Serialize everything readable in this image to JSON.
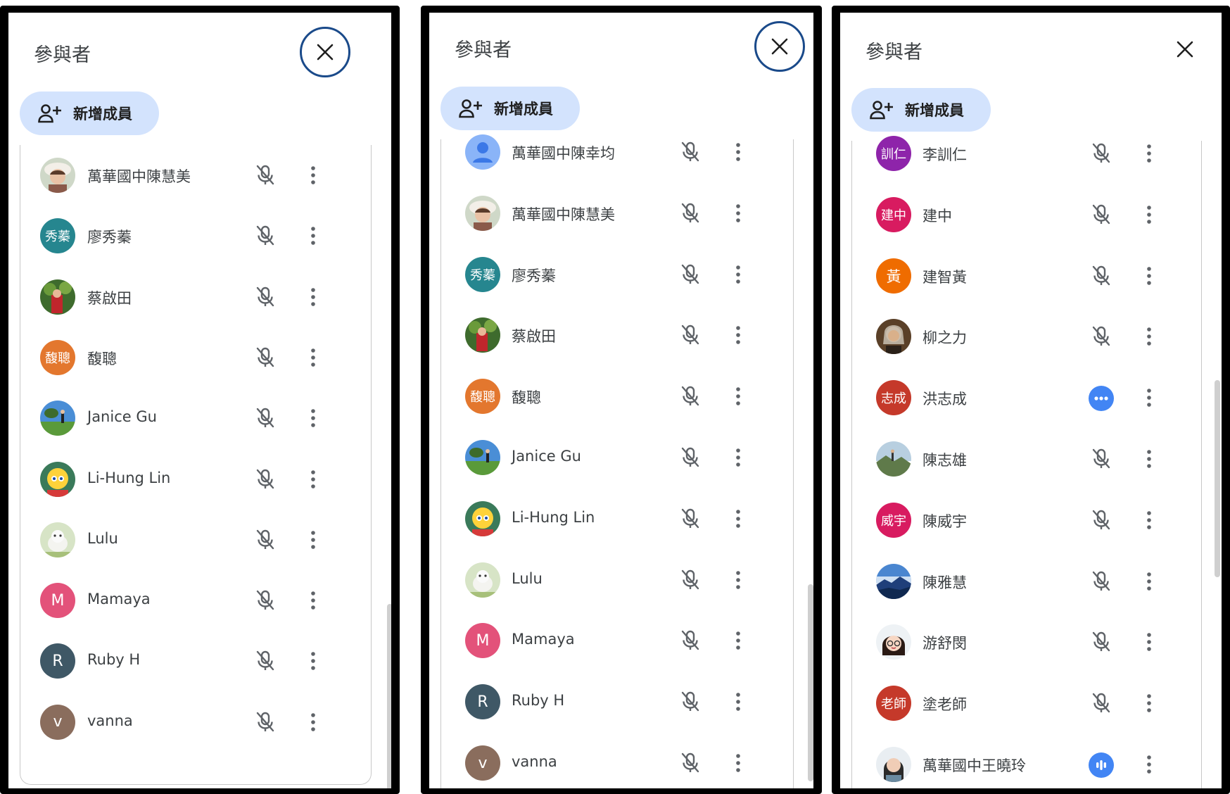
{
  "title": "參與者",
  "add_member_label": "新增成員",
  "panels": [
    {
      "rows": [
        {
          "name": "萬華國中陳慧美",
          "avatar": {
            "kind": "photo",
            "icon": "woman-hat-photo"
          }
        },
        {
          "name": "廖秀蓁",
          "avatar": {
            "kind": "text",
            "text": "秀蓁",
            "color": "#26868f"
          }
        },
        {
          "name": "蔡啟田",
          "avatar": {
            "kind": "photo",
            "icon": "flowers-photo"
          }
        },
        {
          "name": "馥聰",
          "avatar": {
            "kind": "text",
            "text": "馥聰",
            "color": "#e3772e"
          }
        },
        {
          "name": "Janice Gu",
          "avatar": {
            "kind": "photo",
            "icon": "park-photo"
          }
        },
        {
          "name": "Li-Hung Lin",
          "avatar": {
            "kind": "photo",
            "icon": "cartoon-photo"
          }
        },
        {
          "name": "Lulu",
          "avatar": {
            "kind": "photo",
            "icon": "dog-photo"
          }
        },
        {
          "name": "Mamaya",
          "avatar": {
            "kind": "letter",
            "text": "M",
            "color": "#e3527a"
          }
        },
        {
          "name": "Ruby H",
          "avatar": {
            "kind": "letter",
            "text": "R",
            "color": "#3f5866"
          }
        },
        {
          "name": "vanna",
          "avatar": {
            "kind": "letter",
            "text": "v",
            "color": "#8a6d5d"
          }
        }
      ]
    },
    {
      "rows": [
        {
          "name": "萬華國中陳幸均",
          "avatar": {
            "kind": "default",
            "icon": "default-person-avatar"
          }
        },
        {
          "name": "萬華國中陳慧美",
          "avatar": {
            "kind": "photo",
            "icon": "woman-hat-photo"
          }
        },
        {
          "name": "廖秀蓁",
          "avatar": {
            "kind": "text",
            "text": "秀蓁",
            "color": "#26868f"
          }
        },
        {
          "name": "蔡啟田",
          "avatar": {
            "kind": "photo",
            "icon": "flowers-photo"
          }
        },
        {
          "name": "馥聰",
          "avatar": {
            "kind": "text",
            "text": "馥聰",
            "color": "#e3772e"
          }
        },
        {
          "name": "Janice Gu",
          "avatar": {
            "kind": "photo",
            "icon": "park-photo"
          }
        },
        {
          "name": "Li-Hung Lin",
          "avatar": {
            "kind": "photo",
            "icon": "cartoon-photo"
          }
        },
        {
          "name": "Lulu",
          "avatar": {
            "kind": "photo",
            "icon": "dog-photo"
          }
        },
        {
          "name": "Mamaya",
          "avatar": {
            "kind": "letter",
            "text": "M",
            "color": "#e3527a"
          }
        },
        {
          "name": "Ruby H",
          "avatar": {
            "kind": "letter",
            "text": "R",
            "color": "#3f5866"
          }
        },
        {
          "name": "vanna",
          "avatar": {
            "kind": "letter",
            "text": "v",
            "color": "#8a6d5d"
          }
        }
      ]
    },
    {
      "rows": [
        {
          "name": "李訓仁",
          "avatar": {
            "kind": "text",
            "text": "訓仁",
            "color": "#8e24aa"
          }
        },
        {
          "name": "建中",
          "avatar": {
            "kind": "text",
            "text": "建中",
            "color": "#d81b60"
          }
        },
        {
          "name": "建智黃",
          "avatar": {
            "kind": "text",
            "text": "黃",
            "color": "#ef6c00"
          }
        },
        {
          "name": "柳之力",
          "avatar": {
            "kind": "photo",
            "icon": "portrait-photo"
          }
        },
        {
          "name": "洪志成",
          "avatar": {
            "kind": "text",
            "text": "志成",
            "color": "#c5392a"
          },
          "status": "more-dots-icon"
        },
        {
          "name": "陳志雄",
          "avatar": {
            "kind": "photo",
            "icon": "landscape-photo"
          }
        },
        {
          "name": "陳威宇",
          "avatar": {
            "kind": "text",
            "text": "威宇",
            "color": "#d81b60"
          }
        },
        {
          "name": "陳雅慧",
          "avatar": {
            "kind": "photo",
            "icon": "mountain-photo"
          }
        },
        {
          "name": "游舒閔",
          "avatar": {
            "kind": "photo",
            "icon": "girl-glasses-photo"
          }
        },
        {
          "name": "塗老師",
          "avatar": {
            "kind": "text",
            "text": "老師",
            "color": "#c5392a"
          }
        },
        {
          "name": "萬華國中王曉玲",
          "avatar": {
            "kind": "photo",
            "icon": "woman-photo"
          },
          "status": "speaking-wave-icon"
        }
      ]
    }
  ],
  "colors": {
    "accent": "#d3e3fd",
    "close_ring": "#1a4a8a",
    "icon_gray": "#5f6368",
    "speaking_blue": "#4285f4"
  }
}
